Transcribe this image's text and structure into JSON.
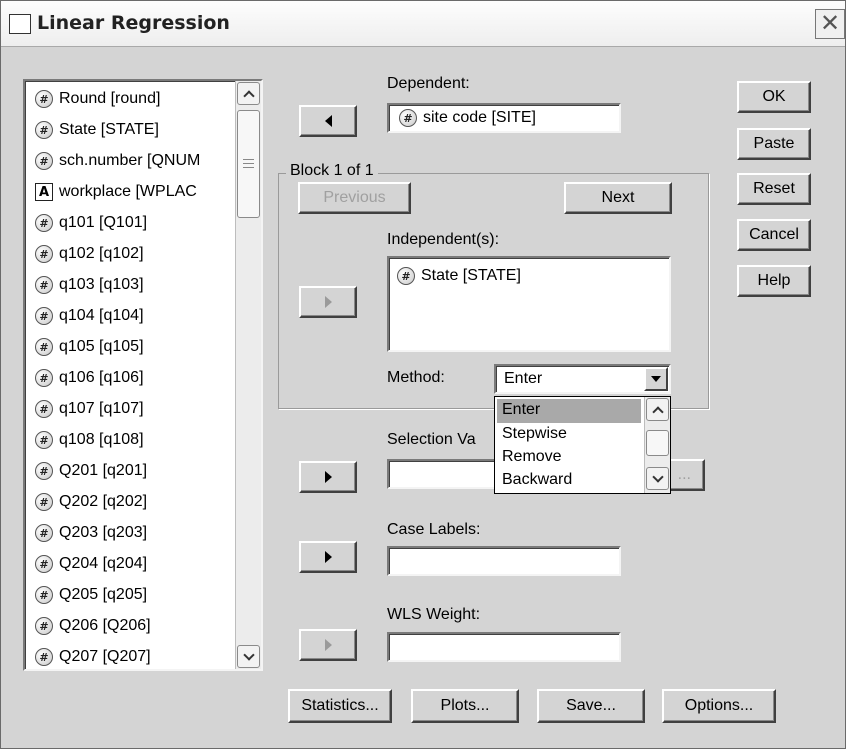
{
  "window": {
    "title": "Linear Regression",
    "close_glyph": "✕"
  },
  "variables": [
    {
      "label": "Round [round]",
      "icon": "numeric-variable-icon"
    },
    {
      "label": "State [STATE]",
      "icon": "numeric-variable-icon"
    },
    {
      "label": "sch.number [QNUM",
      "icon": "numeric-variable-icon"
    },
    {
      "label": "workplace [WPLAC",
      "icon": "string-variable-icon"
    },
    {
      "label": "q101 [Q101]",
      "icon": "numeric-variable-icon"
    },
    {
      "label": "q102 [q102]",
      "icon": "numeric-variable-icon"
    },
    {
      "label": "q103 [q103]",
      "icon": "numeric-variable-icon"
    },
    {
      "label": "q104 [q104]",
      "icon": "numeric-variable-icon"
    },
    {
      "label": "q105 [q105]",
      "icon": "numeric-variable-icon"
    },
    {
      "label": "q106 [q106]",
      "icon": "numeric-variable-icon"
    },
    {
      "label": "q107 [q107]",
      "icon": "numeric-variable-icon"
    },
    {
      "label": "q108 [q108]",
      "icon": "numeric-variable-icon"
    },
    {
      "label": "Q201 [q201]",
      "icon": "numeric-variable-icon"
    },
    {
      "label": "Q202 [q202]",
      "icon": "numeric-variable-icon"
    },
    {
      "label": "Q203 [q203]",
      "icon": "numeric-variable-icon"
    },
    {
      "label": "Q204 [q204]",
      "icon": "numeric-variable-icon"
    },
    {
      "label": "Q205 [q205]",
      "icon": "numeric-variable-icon"
    },
    {
      "label": "Q206 [Q206]",
      "icon": "numeric-variable-icon"
    },
    {
      "label": "Q207 [Q207]",
      "icon": "numeric-variable-icon"
    }
  ],
  "dependent": {
    "label": "Dependent:",
    "value": "site code [SITE]"
  },
  "block": {
    "label": "Block 1 of 1",
    "previous": "Previous",
    "next": "Next"
  },
  "independents": {
    "label": "Independent(s):",
    "items": [
      "State [STATE]"
    ]
  },
  "method": {
    "label": "Method:",
    "selected": "Enter",
    "options": [
      "Enter",
      "Stepwise",
      "Remove",
      "Backward"
    ]
  },
  "selection_variable": {
    "label": "Selection Va",
    "rule_button": "..."
  },
  "case_labels": {
    "label": "Case Labels:"
  },
  "wls_weight": {
    "label": "WLS Weight:"
  },
  "side_buttons": {
    "ok": "OK",
    "paste": "Paste",
    "reset": "Reset",
    "cancel": "Cancel",
    "help": "Help"
  },
  "bottom_buttons": {
    "statistics": "Statistics...",
    "plots": "Plots...",
    "save": "Save...",
    "options": "Options..."
  },
  "colors": {
    "dialog_bg": "#d4d4d4",
    "selection_highlight": "#a9a9a9"
  }
}
